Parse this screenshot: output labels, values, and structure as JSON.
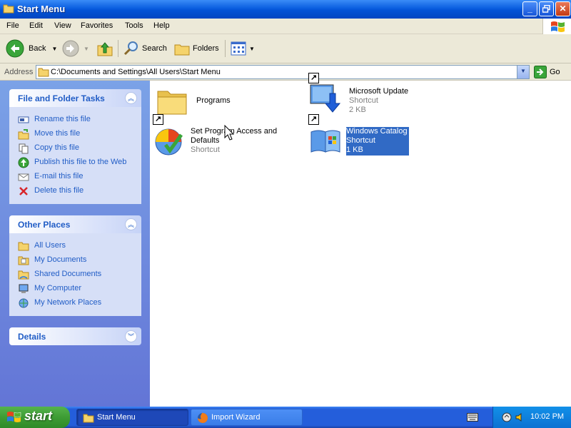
{
  "window": {
    "title": "Start Menu",
    "buttons": {
      "minimize": "_",
      "maximize": "▫",
      "close": "✕"
    }
  },
  "menu": [
    "File",
    "Edit",
    "View",
    "Favorites",
    "Tools",
    "Help"
  ],
  "toolbar": {
    "back": "Back",
    "search": "Search",
    "folders": "Folders"
  },
  "address": {
    "label": "Address",
    "path": "C:\\Documents and Settings\\All Users\\Start Menu",
    "go": "Go"
  },
  "panels": {
    "file_tasks": {
      "title": "File and Folder Tasks",
      "items": [
        {
          "label": "Rename this file",
          "icon": "rename-icon"
        },
        {
          "label": "Move this file",
          "icon": "move-icon"
        },
        {
          "label": "Copy this file",
          "icon": "copy-icon"
        },
        {
          "label": "Publish this file to the Web",
          "icon": "globe-icon"
        },
        {
          "label": "E-mail this file",
          "icon": "email-icon"
        },
        {
          "label": "Delete this file",
          "icon": "delete-icon"
        }
      ]
    },
    "other_places": {
      "title": "Other Places",
      "items": [
        {
          "label": "All Users",
          "icon": "folder-icon"
        },
        {
          "label": "My Documents",
          "icon": "documents-icon"
        },
        {
          "label": "Shared Documents",
          "icon": "shared-folder-icon"
        },
        {
          "label": "My Computer",
          "icon": "computer-icon"
        },
        {
          "label": "My Network Places",
          "icon": "network-icon"
        }
      ]
    },
    "details": {
      "title": "Details"
    }
  },
  "files": [
    {
      "name": "Programs"
    },
    {
      "name": "Microsoft Update",
      "type": "Shortcut",
      "size": "2 KB"
    },
    {
      "name_line1": "Set Program Access and",
      "name_line2": "Defaults",
      "type": "Shortcut"
    },
    {
      "name": "Windows Catalog",
      "type": "Shortcut",
      "size": "1 KB",
      "selected": true
    }
  ],
  "taskbar": {
    "start": "start",
    "tasks": [
      {
        "label": "Start Menu",
        "active": true
      },
      {
        "label": "Import Wizard",
        "active": false
      }
    ],
    "clock": "10:02 PM"
  }
}
